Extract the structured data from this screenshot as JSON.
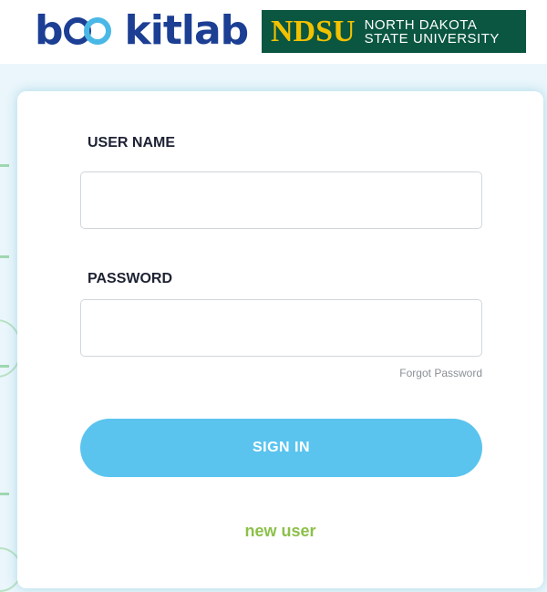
{
  "header": {
    "brand_logo": {
      "text": "bookitlab",
      "prefix": "b",
      "suffix": "kitlab"
    },
    "partner_logo": {
      "short": "NDSU",
      "line1": "NORTH DAKOTA",
      "line2": "STATE UNIVERSITY"
    }
  },
  "login": {
    "username_label": "USER NAME",
    "username_value": "",
    "password_label": "PASSWORD",
    "password_value": "",
    "forgot_password": "Forgot Password",
    "sign_in": "SIGN IN",
    "new_user": "new user"
  },
  "colors": {
    "brand_blue": "#1c3f94",
    "accent_blue": "#5bc4ee",
    "ndsu_green": "#0a5640",
    "ndsu_gold": "#f2c100",
    "link_green": "#8cc04a"
  }
}
